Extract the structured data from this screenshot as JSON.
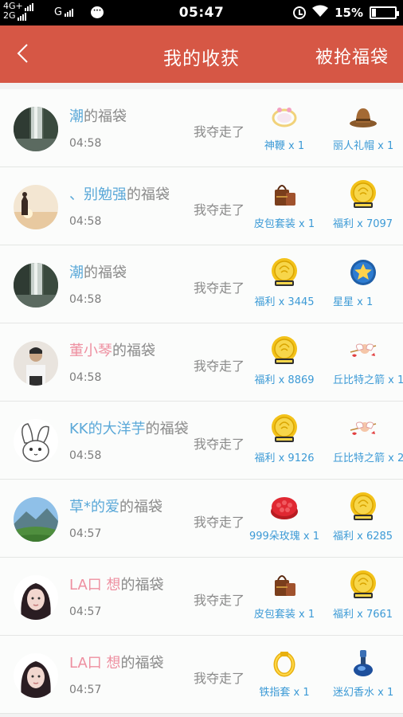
{
  "status_bar": {
    "network_1": "4G+",
    "network_2": "2G",
    "network_3": "G",
    "time": "05:47",
    "battery": "15%",
    "battery_level": 0.15
  },
  "header": {
    "back_icon": "chevron-left-icon",
    "title": "我的收获",
    "right_link": "被抢福袋",
    "color": "#d65745"
  },
  "suffix": "的福袋",
  "took_text": "我夺走了",
  "items": [
    {
      "nick": "潮",
      "time": "04:58",
      "avatar": "waterfall",
      "gifts": [
        {
          "label": "神鞭 x 1",
          "icon": "whip-icon"
        },
        {
          "label": "丽人礼帽 x 1",
          "icon": "hat-icon"
        }
      ]
    },
    {
      "nick": "、别勉强",
      "time": "04:58",
      "avatar": "sunset",
      "gifts": [
        {
          "label": "皮包套装 x 1",
          "icon": "bag-icon"
        },
        {
          "label": "福利 x 7097",
          "icon": "coin-icon"
        }
      ]
    },
    {
      "nick": "潮",
      "time": "04:58",
      "avatar": "waterfall",
      "gifts": [
        {
          "label": "福利 x 3445",
          "icon": "coin-icon"
        },
        {
          "label": "星星 x 1",
          "icon": "star-icon"
        }
      ]
    },
    {
      "nick": "董小琴",
      "time": "04:58",
      "avatar": "person",
      "gifts": [
        {
          "label": "福利 x 8869",
          "icon": "coin-icon"
        },
        {
          "label": "丘比特之箭 x 1",
          "icon": "cupid-icon"
        }
      ]
    },
    {
      "nick": "KK的大洋芋",
      "time": "04:58",
      "avatar": "bunny",
      "gifts": [
        {
          "label": "福利 x 9126",
          "icon": "coin-icon"
        },
        {
          "label": "丘比特之箭 x 2",
          "icon": "cupid-icon"
        }
      ]
    },
    {
      "nick": "草*的爱",
      "time": "04:57",
      "avatar": "mountain",
      "gifts": [
        {
          "label": "999朵玫瑰 x 1",
          "icon": "rose-icon"
        },
        {
          "label": "福利 x 6285",
          "icon": "coin-icon"
        }
      ]
    },
    {
      "nick": "LA口 想",
      "time": "04:57",
      "avatar": "girl",
      "gifts": [
        {
          "label": "皮包套装 x 1",
          "icon": "bag-icon"
        },
        {
          "label": "福利 x 7661",
          "icon": "coin-icon"
        }
      ]
    },
    {
      "nick": "LA口 想",
      "time": "04:57",
      "avatar": "girl",
      "gifts": [
        {
          "label": "铁指套 x 1",
          "icon": "ring-icon"
        },
        {
          "label": "迷幻香水 x 1",
          "icon": "perfume-icon"
        }
      ]
    }
  ]
}
